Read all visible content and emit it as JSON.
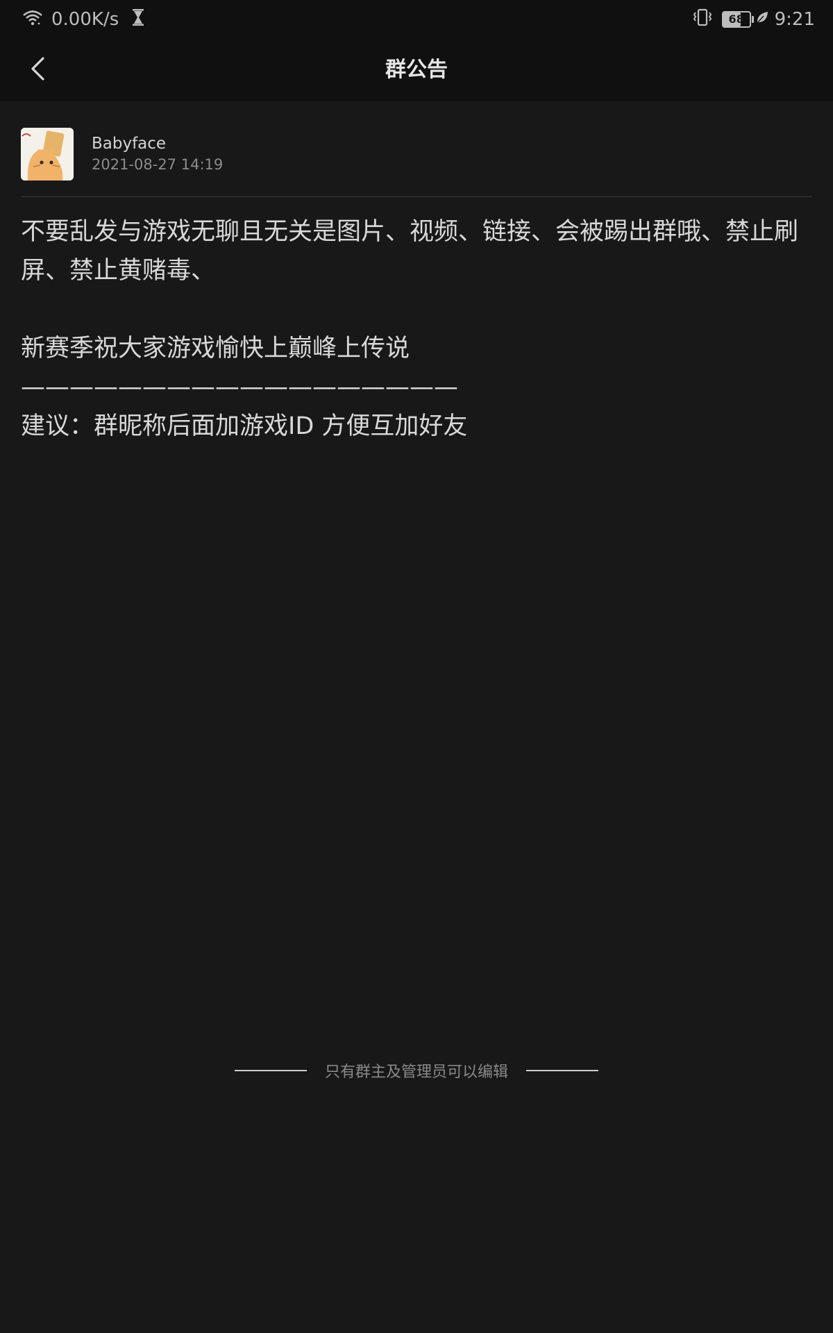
{
  "status_bar": {
    "network_speed": "0.00K/s",
    "battery_level": "68",
    "battery_fraction": 0.68,
    "time": "9:21",
    "icons": [
      "wifi-icon",
      "hourglass-icon",
      "vibrate-icon",
      "battery-icon",
      "leaf-icon"
    ]
  },
  "header": {
    "title": "群公告",
    "back_icon": "chevron-left-icon"
  },
  "announcement": {
    "author_name": "Babyface",
    "timestamp": "2021-08-27 14:19",
    "body": "不要乱发与游戏无聊且无关是图片、视频、链接、会被踢出群哦、禁止刷屏、禁止黄赌毒、\n\n新赛季祝大家游戏愉快上巅峰上传说\n——————————————————\n建议：群昵称后面加游戏ID 方便互加好友"
  },
  "footer": {
    "note": "只有群主及管理员可以编辑"
  },
  "colors": {
    "background": "#181818",
    "bar": "#101010",
    "text": "#d8d8d8",
    "muted": "#8a8a8a"
  }
}
